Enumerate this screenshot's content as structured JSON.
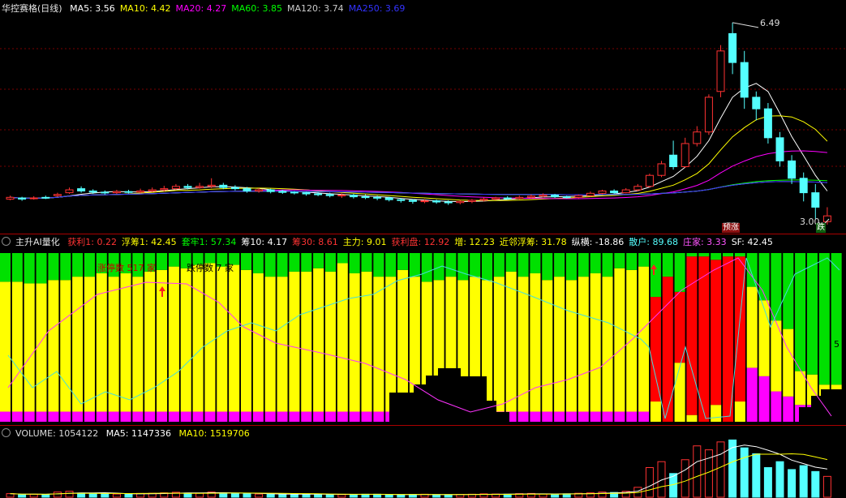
{
  "main": {
    "title": "华控赛格(日线)",
    "ma": [
      {
        "label": "MA5: 3.56",
        "color": "#ffffff"
      },
      {
        "label": "MA10: 4.42",
        "color": "#ffff00"
      },
      {
        "label": "MA20: 4.27",
        "color": "#ff00ff"
      },
      {
        "label": "MA60: 3.85",
        "color": "#00ff00"
      },
      {
        "label": "MA120: 3.74",
        "color": "#cccccc"
      },
      {
        "label": "MA250: 3.69",
        "color": "#3333ff"
      }
    ],
    "high_label": "6.49",
    "low_label": "3.00",
    "tag_yuzhang": "预涨",
    "tag_die": "跌"
  },
  "indicator": {
    "title": "主升AI量化",
    "items": [
      {
        "label": "获利1: 0.22",
        "color": "#ff3333"
      },
      {
        "label": "浮筹1: 42.45",
        "color": "#ffff00"
      },
      {
        "label": "套牢1: 57.34",
        "color": "#00ff00"
      },
      {
        "label": "筹10: 4.17",
        "color": "#ffffff"
      },
      {
        "label": "筹30: 8.61",
        "color": "#ff3333"
      },
      {
        "label": "主力: 9.01",
        "color": "#ffff00"
      },
      {
        "label": "获利盘: 12.92",
        "color": "#ff3333"
      },
      {
        "label": "增: 12.23",
        "color": "#ffff00"
      },
      {
        "label": "近邻浮筹: 31.78",
        "color": "#ffff00"
      },
      {
        "label": "纵横: -18.86",
        "color": "#ffffff"
      },
      {
        "label": "散户: 89.68",
        "color": "#55ffff"
      },
      {
        "label": "庄家: 3.33",
        "color": "#ff55ff"
      },
      {
        "label": "SF: 42.45",
        "color": "#ffffff"
      }
    ],
    "zt_label": "涨停数 517 家",
    "dt_label": "跌停数 7 家",
    "right_tick": "5"
  },
  "volume": {
    "title": "VOLUME: 1054122",
    "ma5": "MA5: 1147336",
    "ma10": "MA10: 1519706"
  },
  "chart_data": [
    {
      "type": "candlestick",
      "title": "华控赛格(日线)",
      "ylim": [
        2.9,
        6.6
      ],
      "candles": [
        [
          3.44,
          3.47,
          3.42,
          3.5
        ],
        [
          3.46,
          3.44,
          3.41,
          3.48
        ],
        [
          3.45,
          3.46,
          3.43,
          3.49
        ],
        [
          3.47,
          3.46,
          3.44,
          3.5
        ],
        [
          3.5,
          3.52,
          3.48,
          3.55
        ],
        [
          3.55,
          3.6,
          3.53,
          3.64
        ],
        [
          3.62,
          3.58,
          3.55,
          3.66
        ],
        [
          3.58,
          3.56,
          3.53,
          3.61
        ],
        [
          3.56,
          3.55,
          3.52,
          3.59
        ],
        [
          3.55,
          3.57,
          3.53,
          3.6
        ],
        [
          3.57,
          3.56,
          3.54,
          3.6
        ],
        [
          3.56,
          3.58,
          3.54,
          3.62
        ],
        [
          3.58,
          3.6,
          3.56,
          3.64
        ],
        [
          3.6,
          3.62,
          3.57,
          3.67
        ],
        [
          3.62,
          3.66,
          3.6,
          3.7
        ],
        [
          3.66,
          3.64,
          3.61,
          3.7
        ],
        [
          3.64,
          3.66,
          3.62,
          3.72
        ],
        [
          3.66,
          3.68,
          3.63,
          3.8
        ],
        [
          3.68,
          3.64,
          3.61,
          3.72
        ],
        [
          3.64,
          3.62,
          3.59,
          3.68
        ],
        [
          3.62,
          3.58,
          3.55,
          3.65
        ],
        [
          3.58,
          3.6,
          3.55,
          3.63
        ],
        [
          3.6,
          3.57,
          3.54,
          3.62
        ],
        [
          3.57,
          3.56,
          3.53,
          3.6
        ],
        [
          3.56,
          3.55,
          3.52,
          3.58
        ],
        [
          3.55,
          3.53,
          3.5,
          3.57
        ],
        [
          3.53,
          3.52,
          3.49,
          3.56
        ],
        [
          3.52,
          3.5,
          3.47,
          3.55
        ],
        [
          3.5,
          3.51,
          3.46,
          3.54
        ],
        [
          3.51,
          3.48,
          3.45,
          3.53
        ],
        [
          3.48,
          3.47,
          3.44,
          3.52
        ],
        [
          3.47,
          3.46,
          3.42,
          3.5
        ],
        [
          3.46,
          3.43,
          3.4,
          3.48
        ],
        [
          3.43,
          3.42,
          3.38,
          3.46
        ],
        [
          3.42,
          3.4,
          3.36,
          3.44
        ],
        [
          3.4,
          3.41,
          3.37,
          3.44
        ],
        [
          3.41,
          3.39,
          3.36,
          3.43
        ],
        [
          3.39,
          3.38,
          3.34,
          3.42
        ],
        [
          3.38,
          3.4,
          3.35,
          3.42
        ],
        [
          3.4,
          3.42,
          3.37,
          3.44
        ],
        [
          3.42,
          3.44,
          3.4,
          3.47
        ],
        [
          3.44,
          3.46,
          3.42,
          3.48
        ],
        [
          3.46,
          3.45,
          3.43,
          3.49
        ],
        [
          3.45,
          3.47,
          3.43,
          3.5
        ],
        [
          3.47,
          3.49,
          3.45,
          3.52
        ],
        [
          3.49,
          3.51,
          3.47,
          3.54
        ],
        [
          3.51,
          3.48,
          3.46,
          3.53
        ],
        [
          3.48,
          3.47,
          3.45,
          3.5
        ],
        [
          3.47,
          3.5,
          3.45,
          3.52
        ],
        [
          3.5,
          3.54,
          3.48,
          3.57
        ],
        [
          3.54,
          3.58,
          3.52,
          3.6
        ],
        [
          3.58,
          3.55,
          3.53,
          3.61
        ],
        [
          3.55,
          3.6,
          3.54,
          3.63
        ],
        [
          3.6,
          3.66,
          3.58,
          3.7
        ],
        [
          3.66,
          3.85,
          3.64,
          3.88
        ],
        [
          3.85,
          4.05,
          3.82,
          4.1
        ],
        [
          4.2,
          4.0,
          3.95,
          4.45
        ],
        [
          4.0,
          4.4,
          3.98,
          4.5
        ],
        [
          4.4,
          4.6,
          4.35,
          4.7
        ],
        [
          4.6,
          5.2,
          4.55,
          5.25
        ],
        [
          5.3,
          6.0,
          5.2,
          6.1
        ],
        [
          6.3,
          5.8,
          5.6,
          6.49
        ],
        [
          5.8,
          5.2,
          5.0,
          6.0
        ],
        [
          5.2,
          5.0,
          4.8,
          5.3
        ],
        [
          5.0,
          4.5,
          4.4,
          5.1
        ],
        [
          4.5,
          4.1,
          4.0,
          4.6
        ],
        [
          4.1,
          3.8,
          3.7,
          4.2
        ],
        [
          3.8,
          3.55,
          3.4,
          3.9
        ],
        [
          3.55,
          3.3,
          3.1,
          3.7
        ],
        [
          3.05,
          3.15,
          3.0,
          3.3
        ]
      ]
    },
    {
      "type": "stacked-bar",
      "title": "主升AI量化",
      "ylim": [
        0,
        100
      ],
      "series": [
        {
          "name": "获利1",
          "values": [
            0,
            0,
            0,
            0,
            0,
            0,
            0,
            0,
            0,
            0,
            0,
            0,
            0,
            0,
            0,
            0,
            0,
            0,
            0,
            0,
            0,
            0,
            0,
            0,
            0,
            0,
            0,
            0,
            0,
            0,
            0,
            0,
            0,
            0,
            0,
            0,
            0,
            0,
            0,
            0,
            0,
            0,
            0,
            0,
            0,
            0,
            0,
            0,
            0,
            0,
            0,
            0,
            0,
            0,
            62,
            86,
            42,
            94,
            98,
            86,
            98,
            86,
            0,
            0,
            0,
            0,
            0,
            0,
            0,
            0
          ]
        },
        {
          "name": "浮筹1",
          "values": [
            77,
            77,
            76,
            76,
            78,
            78,
            80,
            80,
            82,
            80,
            82,
            80,
            83,
            84,
            86,
            85,
            87,
            88,
            86,
            87,
            84,
            82,
            80,
            80,
            83,
            83,
            85,
            83,
            88,
            82,
            83,
            80,
            80,
            84,
            80,
            77,
            78,
            80,
            78,
            80,
            78,
            80,
            83,
            80,
            82,
            78,
            80,
            78,
            80,
            82,
            80,
            85,
            84,
            86,
            12,
            0,
            35,
            4,
            0,
            10,
            0,
            12,
            48,
            45,
            42,
            40,
            20,
            18,
            10,
            12
          ]
        },
        {
          "name": "套牢1",
          "values": [
            17,
            17,
            18,
            18,
            16,
            16,
            14,
            14,
            12,
            14,
            12,
            14,
            11,
            10,
            8,
            9,
            7,
            6,
            8,
            7,
            10,
            12,
            14,
            14,
            11,
            11,
            9,
            11,
            6,
            12,
            11,
            14,
            14,
            10,
            14,
            17,
            16,
            14,
            16,
            14,
            16,
            14,
            11,
            14,
            12,
            16,
            14,
            16,
            14,
            12,
            14,
            9,
            10,
            8,
            26,
            14,
            23,
            2,
            2,
            4,
            2,
            2,
            20,
            28,
            40,
            45,
            70,
            72,
            78,
            78
          ]
        },
        {
          "name": "庄家",
          "values": [
            6,
            6,
            6,
            6,
            6,
            6,
            6,
            6,
            6,
            6,
            6,
            6,
            6,
            6,
            6,
            6,
            6,
            6,
            6,
            6,
            6,
            6,
            6,
            6,
            6,
            6,
            6,
            6,
            6,
            6,
            6,
            6,
            6,
            6,
            6,
            6,
            6,
            6,
            6,
            6,
            6,
            6,
            6,
            6,
            6,
            6,
            6,
            6,
            6,
            6,
            6,
            6,
            6,
            6,
            0,
            0,
            0,
            0,
            0,
            0,
            0,
            0,
            32,
            27,
            18,
            15,
            10,
            10,
            12,
            10
          ]
        }
      ]
    },
    {
      "type": "bar",
      "title": "VOLUME",
      "series": [
        {
          "name": "VOLUME",
          "values": [
            180,
            120,
            150,
            140,
            260,
            300,
            210,
            180,
            170,
            160,
            150,
            190,
            200,
            220,
            250,
            210,
            200,
            260,
            220,
            180,
            170,
            160,
            150,
            150,
            140,
            160,
            150,
            140,
            130,
            140,
            150,
            150,
            120,
            110,
            140,
            150,
            130,
            120,
            140,
            150,
            170,
            160,
            150,
            180,
            190,
            160,
            150,
            170,
            200,
            220,
            260,
            240,
            300,
            500,
            1500,
            1800,
            1200,
            1900,
            2600,
            2400,
            2800,
            2900,
            2500,
            2200,
            1500,
            1800,
            1400,
            1600,
            1300,
            1054
          ]
        }
      ]
    }
  ]
}
